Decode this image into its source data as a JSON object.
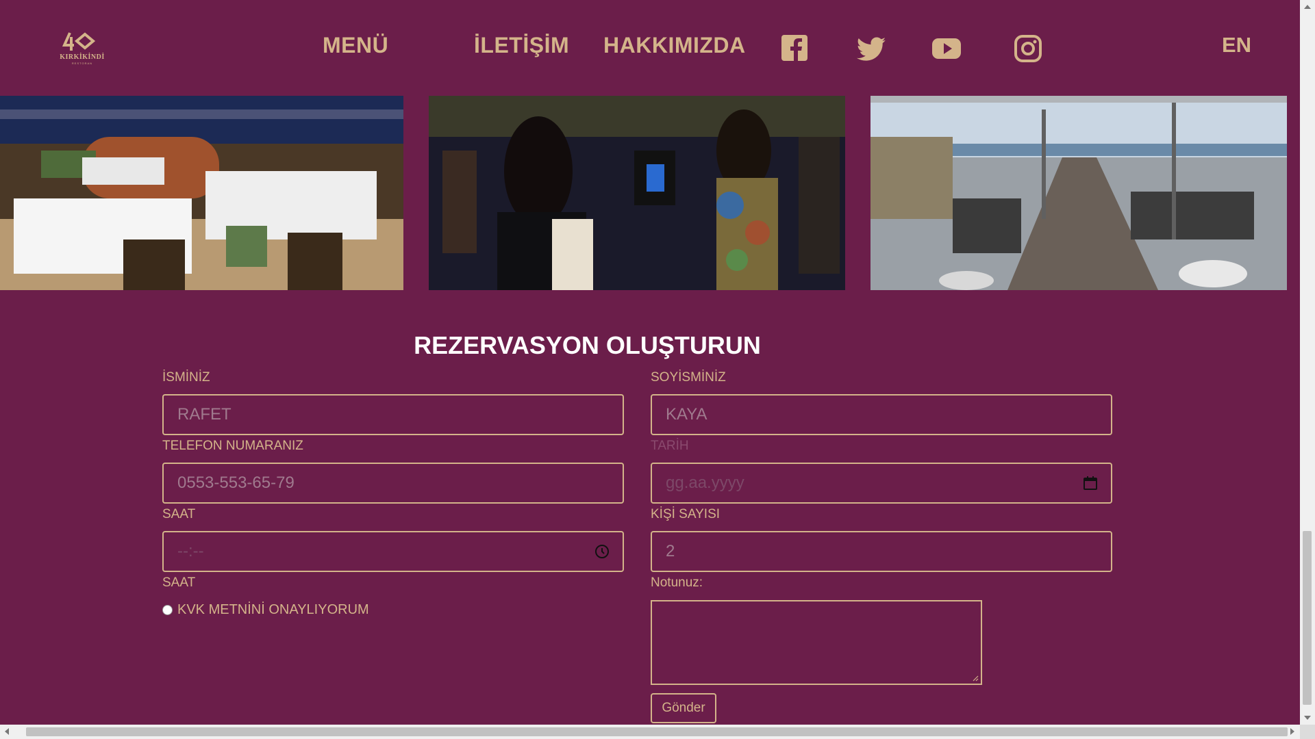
{
  "header": {
    "logo_number": "40",
    "logo_text": "KIRKİKİNDİ",
    "logo_subtext": "RESTORAN",
    "nav": [
      {
        "label": "MENÜ"
      },
      {
        "label": "İLETİŞİM"
      },
      {
        "label": "HAKKIMIZDA"
      }
    ],
    "social_icons": [
      "facebook-icon",
      "twitter-icon",
      "youtube-icon",
      "instagram-icon"
    ],
    "lang": "EN"
  },
  "gallery": [
    {
      "name": "restaurant-interior-photo"
    },
    {
      "name": "live-music-photo"
    },
    {
      "name": "terrace-view-photo"
    }
  ],
  "form": {
    "title": "REZERVASYON OLUŞTURUN",
    "first_name": {
      "label": "İSMİNİZ",
      "placeholder": "RAFET"
    },
    "last_name": {
      "label": "SOYİSMİNİZ",
      "placeholder": "KAYA"
    },
    "phone": {
      "label": "TELEFON NUMARANIZ",
      "placeholder": "0553-553-65-79"
    },
    "date": {
      "label": "TARİH",
      "placeholder": "gg.aa.yyyy"
    },
    "time": {
      "label": "SAAT",
      "placeholder": "--:--"
    },
    "guests": {
      "label": "KİŞİ SAYISI",
      "placeholder": "2"
    },
    "time_label_2": "SAAT",
    "note_label": "Notunuz:",
    "kvk_label": "KVK METNİNİ ONAYLIYORUM",
    "submit_label": "Gönder"
  },
  "colors": {
    "background": "#6b1e4a",
    "accent": "#d4b48a",
    "title": "#ffffff"
  }
}
